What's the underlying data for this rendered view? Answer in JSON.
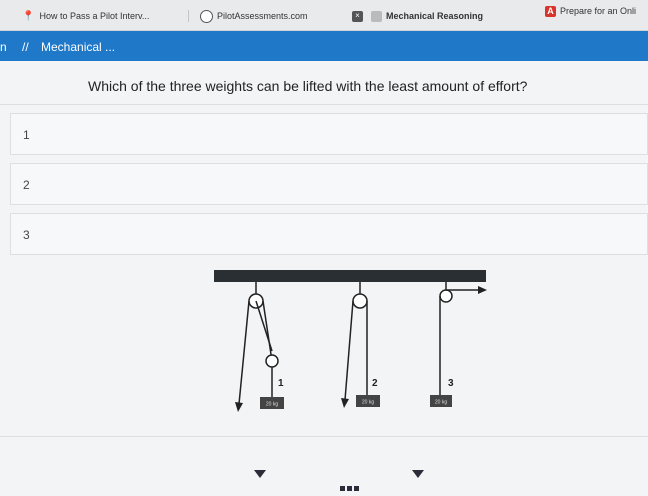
{
  "browser": {
    "tabs": [
      {
        "label": "How to Pass a Pilot Interv...",
        "icon": "pin-icon"
      },
      {
        "label": "PilotAssessments.com",
        "icon": "globe-icon"
      },
      {
        "label": "Mechanical Reasoning",
        "icon": "mechanical-icon"
      },
      {
        "label": "Prepare for an Onli",
        "icon": "a-icon"
      }
    ]
  },
  "nav": {
    "prefix": "n",
    "separator": "//",
    "title": "Mechanical ..."
  },
  "question": "Which of the three weights can be lifted with the least amount of effort?",
  "options": [
    {
      "label": "1"
    },
    {
      "label": "2"
    },
    {
      "label": "3"
    }
  ],
  "diagram": {
    "pulley_labels": [
      "1",
      "2",
      "3"
    ],
    "weight_labels": [
      "20 kg",
      "20 kg",
      "20 kg"
    ]
  },
  "colors": {
    "nav_bar": "#1f78c8",
    "beam": "#2a2f33"
  }
}
